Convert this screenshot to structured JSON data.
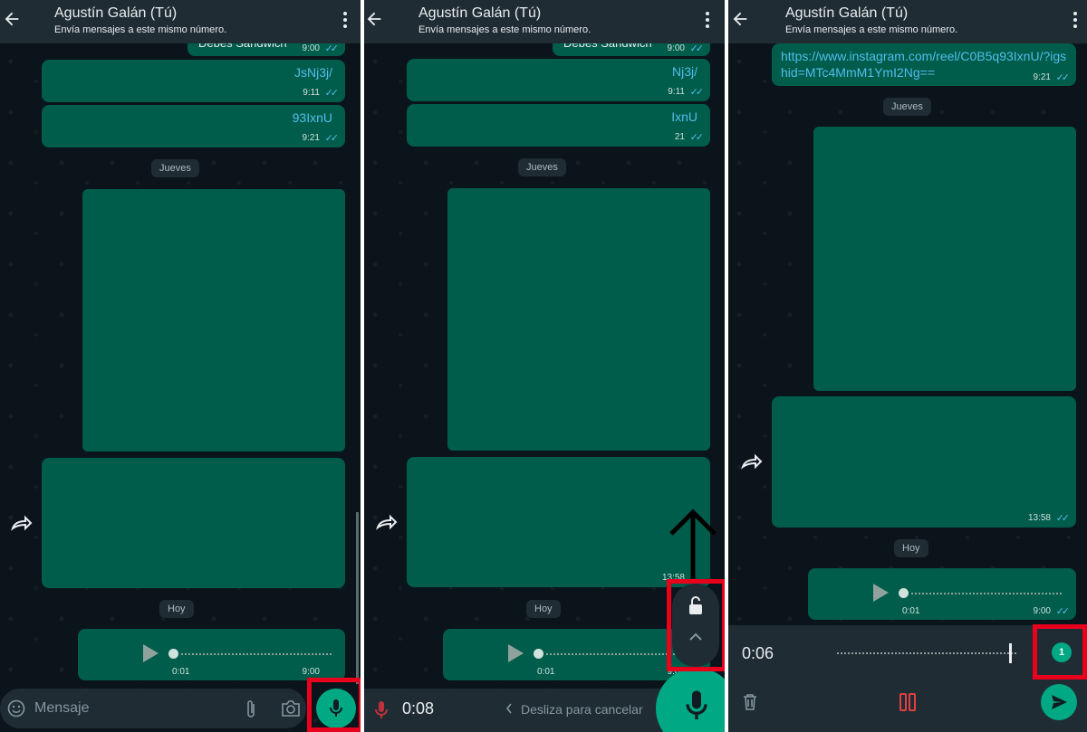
{
  "contact": {
    "name": "Agustín Galán (Tú)",
    "subtitle": "Envía mensajes a este mismo número."
  },
  "panel1": {
    "partial_top_text": "Debes Sandwich",
    "messages": [
      {
        "time": "9:00"
      },
      {
        "text": "JsNj3j/",
        "time": "9:11"
      },
      {
        "text": "93IxnU",
        "time": "9:21"
      },
      {
        "time": ""
      },
      {
        "time": ""
      }
    ],
    "date_jueves": "Jueves",
    "date_hoy": "Hoy",
    "audio": {
      "duration": "0:01",
      "time": "9:00"
    },
    "input_placeholder": "Mensaje"
  },
  "panel2": {
    "partial_top_text": "Debes Sandwich",
    "messages": [
      {
        "time": "9:00"
      },
      {
        "text": "Nj3j/",
        "time": "9:11"
      },
      {
        "text": "IxnU",
        "time": "21"
      },
      {
        "time": "13:58"
      }
    ],
    "date_jueves": "Jueves",
    "date_hoy": "Hoy",
    "audio": {
      "duration": "0:01",
      "time": "9:00"
    },
    "recording_time": "0:08",
    "slide_cancel": "Desliza para cancelar"
  },
  "panel3": {
    "link_text": "https://www.instagram.com/reel/C0B5q93IxnU/?igshid=MTc4MmM1YmI2Ng==",
    "link_time": "9:21",
    "date_jueves": "Jueves",
    "media_time": "13:58",
    "date_hoy": "Hoy",
    "audio": {
      "duration": "0:01",
      "time": "9:00"
    },
    "recording_time": "0:06",
    "view_once_label": "1"
  },
  "colors": {
    "bubble": "#005c4b",
    "background": "#0b141a",
    "header": "#1f2c34",
    "accent": "#00a884",
    "highlight": "#e8001c",
    "tick": "#53bdeb"
  },
  "icons": [
    "back-arrow-icon",
    "more-options-icon",
    "forward-icon",
    "play-icon",
    "emoji-icon",
    "attach-icon",
    "camera-icon",
    "mic-icon",
    "lock-open-icon",
    "chevron-up-icon",
    "chevron-left-icon",
    "delete-icon",
    "pause-icon",
    "send-icon",
    "view-once-icon",
    "double-check-icon",
    "arrow-up-icon"
  ]
}
